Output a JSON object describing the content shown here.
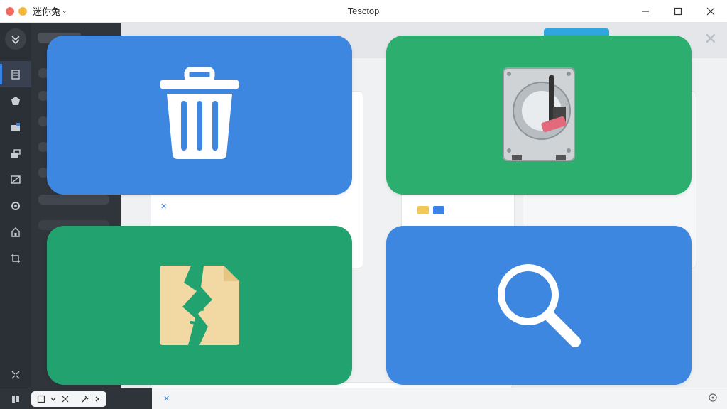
{
  "window": {
    "app_name": "迷你兔",
    "title": "Tesctop"
  },
  "colors": {
    "tile_blue": "#3d87e0",
    "tile_green": "#2bae6e",
    "tile_teal": "#22a26e",
    "sidebar_bg": "#2b2f36",
    "accent": "#3b82e6"
  },
  "sidebar": {
    "logo_icon": "brand-logo-icon",
    "items": [
      {
        "icon": "document-icon",
        "active": true
      },
      {
        "icon": "disk-recover-icon",
        "active": false
      },
      {
        "icon": "partition-icon",
        "active": false
      },
      {
        "icon": "layers-icon",
        "active": false
      },
      {
        "icon": "image-icon",
        "active": false
      },
      {
        "icon": "gear-icon",
        "active": false
      },
      {
        "icon": "home-icon",
        "active": false
      },
      {
        "icon": "crop-icon",
        "active": false
      }
    ],
    "bottom_icon": "expand-icon"
  },
  "tiles": [
    {
      "name": "recycle-bin",
      "icon": "trash-icon",
      "color": "blue"
    },
    {
      "name": "hard-disk",
      "icon": "hard-drive-icon",
      "color": "green"
    },
    {
      "name": "corrupted-file",
      "icon": "broken-file-icon",
      "color": "teal"
    },
    {
      "name": "search",
      "icon": "magnifier-icon",
      "color": "blue"
    }
  ]
}
